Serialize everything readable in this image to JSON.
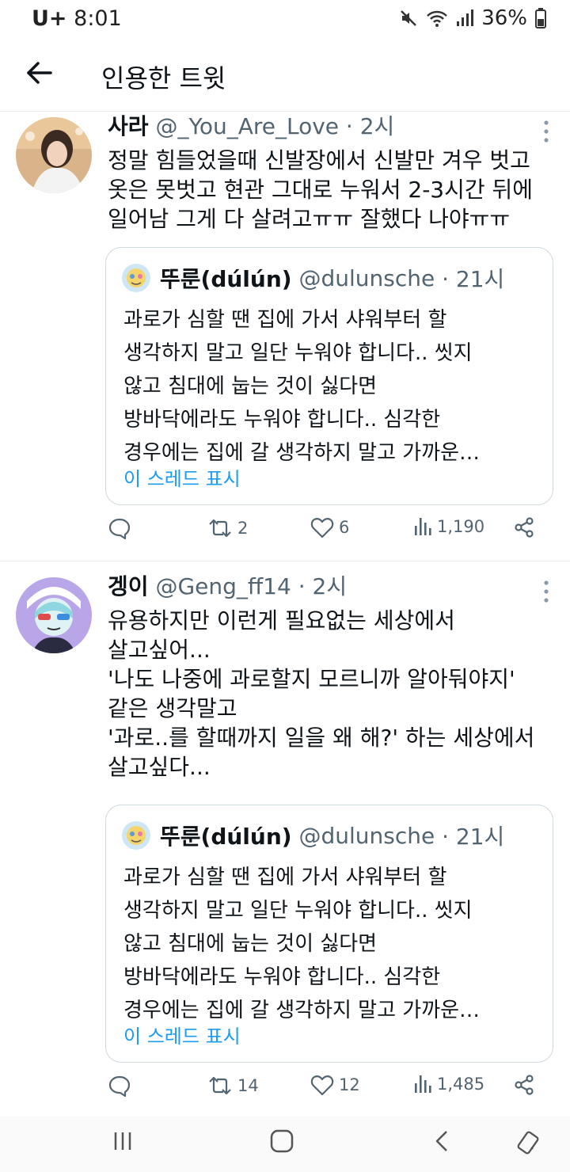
{
  "status_bar": {
    "carrier": "U+",
    "time": "8:01",
    "battery": "36%",
    "icons": [
      "mute-icon",
      "wifi-icon",
      "signal-icon",
      "battery-icon"
    ]
  },
  "app_bar": {
    "title": "인용한 트윗",
    "back_icon": "back-arrow-icon"
  },
  "tweets": [
    {
      "name": "사라",
      "handle": "@_You_Are_Love",
      "time": "· 2시",
      "text": [
        "정말 힘들었을때 신발장에서 신발만 겨우 벗고",
        "옷은 못벗고 현관 그대로 누워서 2-3시간 뒤에",
        "일어남 그게 다 살려고ㅠㅠ 잘했다 나야ㅠㅠ"
      ],
      "quote": {
        "name": "뚜룬(dúlún)",
        "handle": "@dulunsche",
        "time": "· 21시",
        "text": [
          "과로가 심할 땐 집에 가서 샤워부터 할",
          "생각하지 말고 일단 누워야 합니다.. 씻지",
          "않고 침대에 눕는 것이 싫다면",
          "방바닥에라도 누워야 합니다.. 심각한",
          "경우에는 집에 갈 생각하지 말고 가까운…"
        ],
        "show_thread": "이 스레드 표시"
      },
      "actions": {
        "replies": "",
        "retweets": "2",
        "likes": "6",
        "views": "1,190"
      }
    },
    {
      "name": "겡이",
      "handle": "@Geng_ff14",
      "time": "· 2시",
      "text": [
        "유용하지만 이런게 필요없는 세상에서",
        "살고싶어...",
        "'나도 나중에 과로할지 모르니까 알아둬야지'",
        "같은 생각말고",
        "'과로..를 할때까지 일을 왜 해?' 하는 세상에서",
        "살고싶다..."
      ],
      "quote": {
        "name": "뚜룬(dúlún)",
        "handle": "@dulunsche",
        "time": "· 21시",
        "text": [
          "과로가 심할 땐 집에 가서 샤워부터 할",
          "생각하지 말고 일단 누워야 합니다.. 씻지",
          "않고 침대에 눕는 것이 싫다면",
          "방바닥에라도 누워야 합니다.. 심각한",
          "경우에는 집에 갈 생각하지 말고 가까운…"
        ],
        "show_thread": "이 스레드 표시"
      },
      "actions": {
        "replies": "",
        "retweets": "14",
        "likes": "12",
        "views": "1,485"
      }
    }
  ],
  "nav_bar": {
    "icons": [
      "recent-apps-icon",
      "home-icon",
      "back-icon",
      "rotate-icon"
    ]
  },
  "colors": {
    "link": "#1d9bf0",
    "secondary_text": "#536471",
    "border": "#cfd9de"
  }
}
